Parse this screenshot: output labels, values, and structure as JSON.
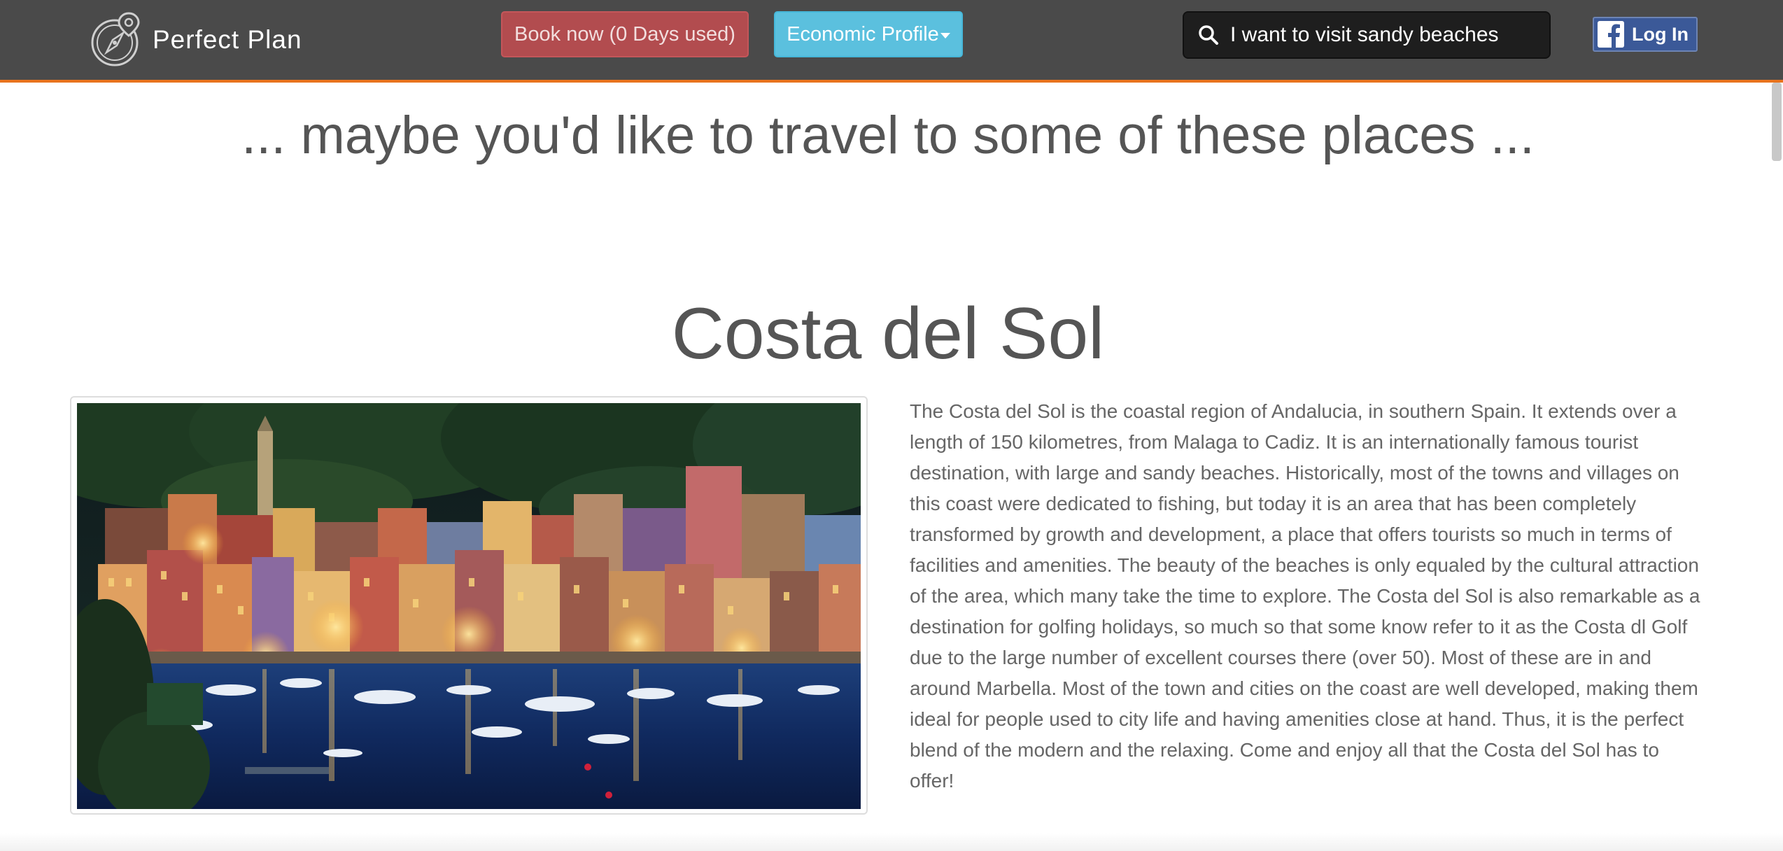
{
  "brand": {
    "name": "Perfect Plan",
    "logo_icon": "compass-pin-icon"
  },
  "nav": {
    "book_label": "Book now (0 Days used)",
    "economic_profile_label": "Economic Profile",
    "search_value": "I want to visit sandy beaches",
    "search_icon": "search-icon",
    "login_label": "Log In",
    "login_icon": "facebook-icon"
  },
  "colors": {
    "navbar_bg": "#4a4a4a",
    "navbar_accent": "#e8731d",
    "book_button": "#b24c4f",
    "economic_button": "#5bc0de",
    "facebook_blue": "#3b5998",
    "text_gray": "#555555"
  },
  "main": {
    "tagline": "... maybe you'd like to travel to some of these places ...",
    "destination": {
      "title": "Costa del Sol",
      "description": "The Costa del Sol is the coastal region of Andalucia, in southern Spain. It extends over a length of 150 kilometres, from Malaga to Cadiz. It is an internationally famous tourist destination, with large and sandy beaches. Historically, most of the towns and villages on this coast were dedicated to fishing, but today it is an area that has been completely transformed by growth and development, a place that offers tourists so much in terms of facilities and amenities. The beauty of the beaches is only equaled by the cultural attraction of the area, which many take the time to explore. The Costa del Sol is also remarkable as a destination for golfing holidays, so much so that some know refer to it as the Costa dl Golf due to the large number of excellent courses there (over 50). Most of these are in and around Marbella. Most of the town and cities on the coast are well developed, making them ideal for people used to city life and having amenities close at hand. Thus, it is the perfect blend of the modern and the relaxing. Come and enjoy all that the Costa del Sol has to offer!"
    }
  }
}
